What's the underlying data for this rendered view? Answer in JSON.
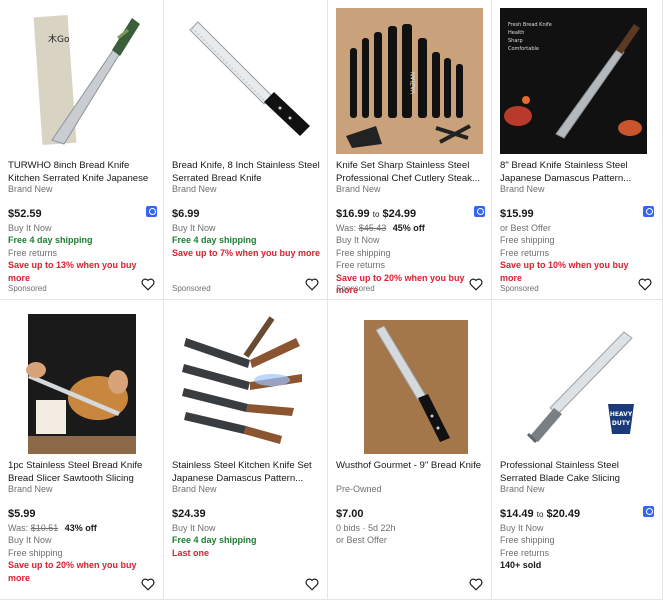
{
  "listings": [
    {
      "title": "TURWHO 8inch Bread Knife Kitchen Serrated Knife Japanese VG10...",
      "condition": "Brand New",
      "price": "$52.59",
      "lines": [
        {
          "text": "Buy It Now",
          "style": "gray"
        },
        {
          "text": "Free 4 day shipping",
          "style": "green"
        },
        {
          "text": "Free returns",
          "style": "gray"
        },
        {
          "text": "Save up to 13% when you buy more",
          "style": "red"
        }
      ],
      "sponsored": "Sponsored",
      "badge": true
    },
    {
      "title": "Bread Knife, 8 Inch Stainless Steel Serrated Bread Knife",
      "condition": "Brand New",
      "price": "$6.99",
      "lines": [
        {
          "text": "Buy It Now",
          "style": "gray"
        },
        {
          "text": "Free 4 day shipping",
          "style": "green"
        },
        {
          "text": "Save up to 7% when you buy more",
          "style": "red"
        }
      ],
      "sponsored": "Sponsored",
      "badge": false
    },
    {
      "title": "Knife Set Sharp Stainless Steel Professional Chef Cutlery Steak...",
      "condition": "Brand New",
      "price_low": "$16.99",
      "price_to": "to",
      "price_high": "$24.99",
      "was": "Was:",
      "was_price": "$45.43",
      "off": "45% off",
      "lines": [
        {
          "text": "Buy It Now",
          "style": "gray"
        },
        {
          "text": "Free shipping",
          "style": "gray"
        },
        {
          "text": "Free returns",
          "style": "gray"
        },
        {
          "text": "Save up to 20% when you buy more",
          "style": "red"
        }
      ],
      "sponsored": "Sponsored",
      "badge": true
    },
    {
      "title": "8\" Bread Knife Stainless Steel Japanese Damascus Pattern...",
      "condition": "Brand New",
      "price": "$15.99",
      "lines": [
        {
          "text": "or Best Offer",
          "style": "gray"
        },
        {
          "text": "Free shipping",
          "style": "gray"
        },
        {
          "text": "Free returns",
          "style": "gray"
        },
        {
          "text": "Save up to 10% when you buy more",
          "style": "red"
        }
      ],
      "sponsored": "Sponsored",
      "badge": true,
      "image_text": [
        "Fresh Bread Knife",
        "Health",
        "Sharp",
        "Comfortable"
      ]
    },
    {
      "title": "1pc Stainless Steel Bread Knife Bread Slicer Sawtooth Slicing Tool...",
      "condition": "Brand New",
      "price": "$5.99",
      "was": "Was:",
      "was_price": "$10.51",
      "off": "43% off",
      "lines": [
        {
          "text": "Buy It Now",
          "style": "gray"
        },
        {
          "text": "Free shipping",
          "style": "gray"
        },
        {
          "text": "Save up to 20% when you buy more",
          "style": "red"
        }
      ],
      "sponsored": "",
      "badge": false
    },
    {
      "title": "Stainless Steel Kitchen Knife Set Japanese Damascus Pattern...",
      "condition": "Brand New",
      "price": "$24.39",
      "lines": [
        {
          "text": "Buy It Now",
          "style": "gray"
        },
        {
          "text": "Free 4 day shipping",
          "style": "green"
        },
        {
          "text": "Last one",
          "style": "red"
        }
      ],
      "sponsored": "",
      "badge": false
    },
    {
      "title": "Wusthof Gourmet - 9\" Bread Knife",
      "condition": "Pre-Owned",
      "price": "$7.00",
      "lines": [
        {
          "text": "0 bids · 5d 22h",
          "style": "gray"
        },
        {
          "text": "or Best Offer",
          "style": "gray"
        }
      ],
      "sponsored": "",
      "badge": false
    },
    {
      "title": "Professional Stainless Steel Serrated Blade Cake Slicing Bread...",
      "condition": "Brand New",
      "price_low": "$14.49",
      "price_to": "to",
      "price_high": "$20.49",
      "lines": [
        {
          "text": "Buy It Now",
          "style": "gray"
        },
        {
          "text": "Free shipping",
          "style": "gray"
        },
        {
          "text": "Free returns",
          "style": "gray"
        },
        {
          "text": "140+ sold",
          "style": "boldk"
        }
      ],
      "sponsored": "",
      "badge": true,
      "image_text": [
        "HEAVY",
        "DUTY"
      ]
    }
  ],
  "icons": {
    "heart": "heart-outline-icon",
    "badge": "top-rated-seller-icon"
  },
  "colors": {
    "accent_blue": "#3665f3",
    "green": "#1e7e34",
    "red": "#dd1e31",
    "gray": "#707070"
  }
}
